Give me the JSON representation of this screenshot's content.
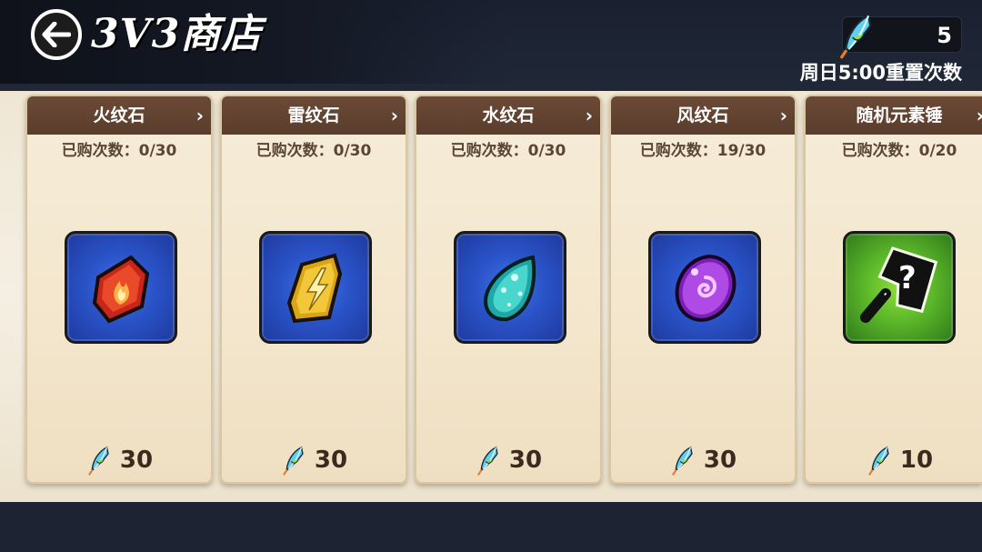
{
  "header": {
    "title": "3V3商店",
    "currency_amount": "5",
    "reset_text": "周日5:00重置次数"
  },
  "cards": [
    {
      "name": "火纹石",
      "purchased": "已购次数：0/30",
      "price": "30",
      "icon": "fire-stone-icon"
    },
    {
      "name": "雷纹石",
      "purchased": "已购次数：0/30",
      "price": "30",
      "icon": "thunder-stone-icon"
    },
    {
      "name": "水纹石",
      "purchased": "已购次数：0/30",
      "price": "30",
      "icon": "water-stone-icon"
    },
    {
      "name": "风纹石",
      "purchased": "已购次数：19/30",
      "price": "30",
      "icon": "wind-stone-icon"
    },
    {
      "name": "随机元素锤",
      "purchased": "已购次数：0/20",
      "price": "10",
      "icon": "random-element-hammer-icon"
    }
  ],
  "colors": {
    "card_header": "#5a3d2c",
    "frame_blue": "#2a53c8",
    "frame_green": "#5cb82a",
    "fire": "#d7341c",
    "thunder": "#e8b820",
    "water": "#38c8c0",
    "wind": "#a33ad8"
  }
}
